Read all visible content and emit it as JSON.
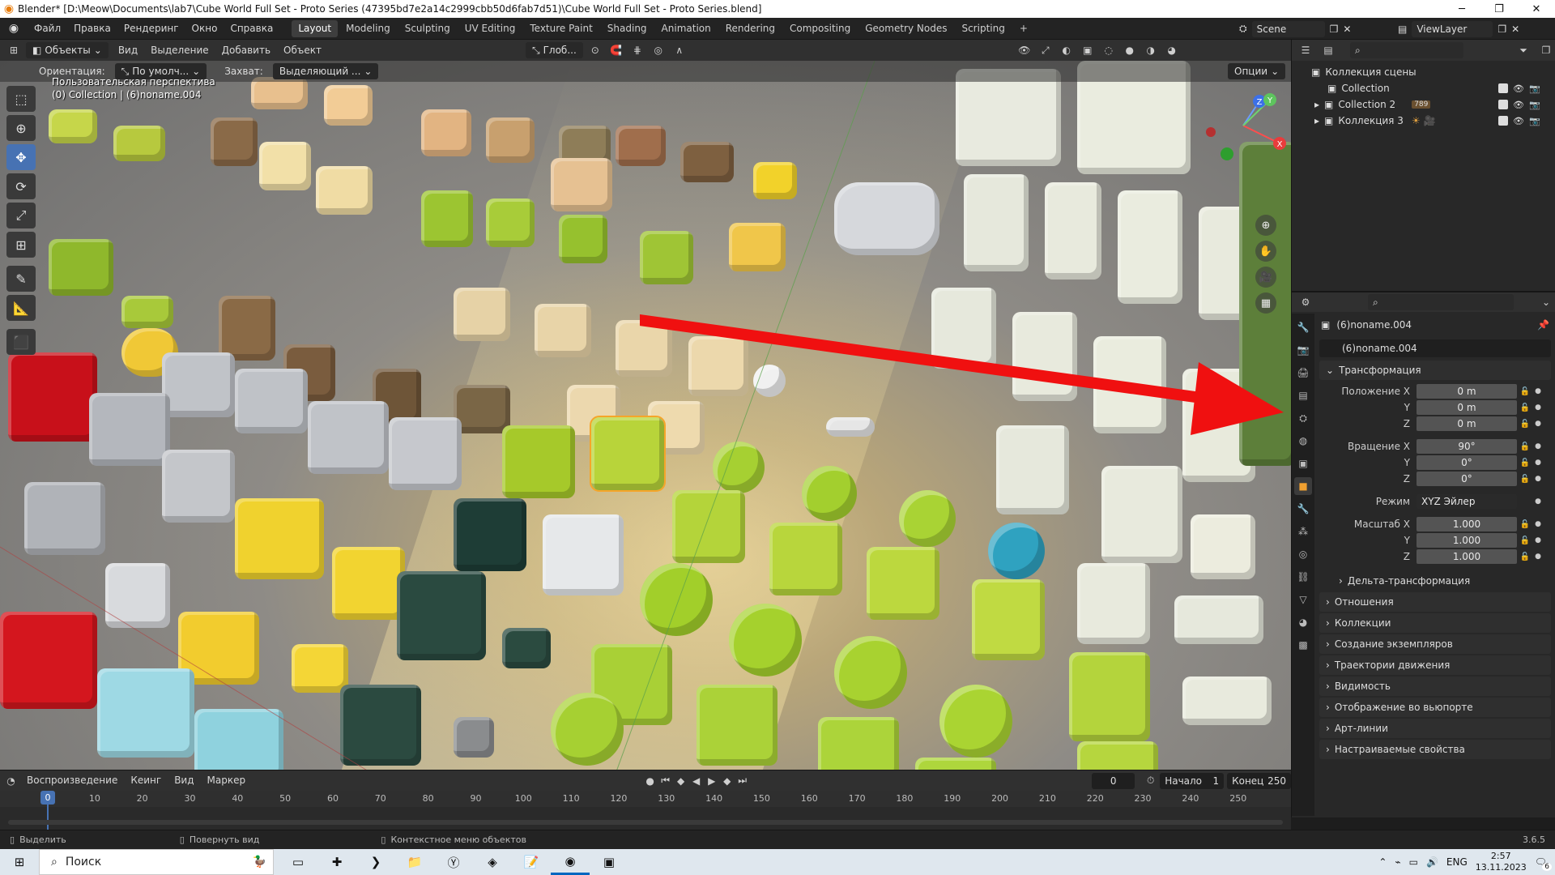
{
  "window": {
    "title": "Blender* [D:\\Meow\\Documents\\lab7\\Cube World Full Set - Proto Series (47395bd7e2a14c2999cbb50d6fab7d51)\\Cube World Full Set - Proto Series.blend]",
    "minimize": "─",
    "maximize": "❐",
    "close": "✕"
  },
  "menu": [
    "Файл",
    "Правка",
    "Рендеринг",
    "Окно",
    "Справка"
  ],
  "workspaces": [
    "Layout",
    "Modeling",
    "Sculpting",
    "UV Editing",
    "Texture Paint",
    "Shading",
    "Animation",
    "Rendering",
    "Compositing",
    "Geometry Nodes",
    "Scripting"
  ],
  "active_workspace": "Layout",
  "scene": {
    "name": "Scene",
    "viewlayer": "ViewLayer"
  },
  "viewport_header": {
    "mode": "Объекты",
    "menus": [
      "Вид",
      "Выделение",
      "Добавить",
      "Объект"
    ],
    "transform": "Глоб...",
    "options": "Опции"
  },
  "viewport_header2": {
    "orientation_label": "Ориентация:",
    "orientation_value": "По умолч...",
    "snap_label": "Захват:",
    "snap_value": "Выделяющий ..."
  },
  "viewport": {
    "line1": "Пользовательская перспектива",
    "line2": "(0) Collection | (6)noname.004"
  },
  "gizmo": {
    "x": "X",
    "y": "Y",
    "z": "Z"
  },
  "outliner": {
    "root": "Коллекция сцены",
    "items": [
      {
        "label": "Collection"
      },
      {
        "label": "Collection 2",
        "badge": "789"
      },
      {
        "label": "Коллекция 3"
      }
    ]
  },
  "properties": {
    "object_name": "(6)noname.004",
    "data_name": "(6)noname.004",
    "transform_title": "Трансформация",
    "location": {
      "label_x": "Положение X",
      "x": "0 m",
      "y": "0 m",
      "z": "0 m"
    },
    "rotation": {
      "label_x": "Вращение X",
      "x": "90°",
      "y": "0°",
      "z": "0°"
    },
    "mode_label": "Режим",
    "mode_value": "XYZ Эйлер",
    "scale": {
      "label_x": "Масштаб X",
      "x": "1.000",
      "y": "1.000",
      "z": "1.000"
    },
    "axis_y": "Y",
    "axis_z": "Z",
    "delta": "Дельта-трансформация",
    "panels": [
      "Отношения",
      "Коллекции",
      "Создание экземпляров",
      "Траектории движения",
      "Видимость",
      "Отображение во вьюпорте",
      "Арт-линии",
      "Настраиваемые свойства"
    ]
  },
  "timeline": {
    "menus": [
      "Воспроизведение",
      "Кеинг",
      "Вид",
      "Маркер"
    ],
    "current": "0",
    "start_label": "Начало",
    "start": "1",
    "end_label": "Конец",
    "end": "250",
    "ticks": [
      "0",
      "10",
      "20",
      "30",
      "40",
      "50",
      "60",
      "70",
      "80",
      "90",
      "100",
      "110",
      "120",
      "130",
      "140",
      "150",
      "160",
      "170",
      "180",
      "190",
      "200",
      "210",
      "220",
      "230",
      "240",
      "250"
    ]
  },
  "status": {
    "select": "Выделить",
    "rotate": "Повернуть вид",
    "context": "Контекстное меню объектов",
    "version": "3.6.5"
  },
  "taskbar": {
    "search": "Поиск",
    "lang": "ENG",
    "time": "2:57",
    "date": "13.11.2023",
    "notif": "6"
  }
}
